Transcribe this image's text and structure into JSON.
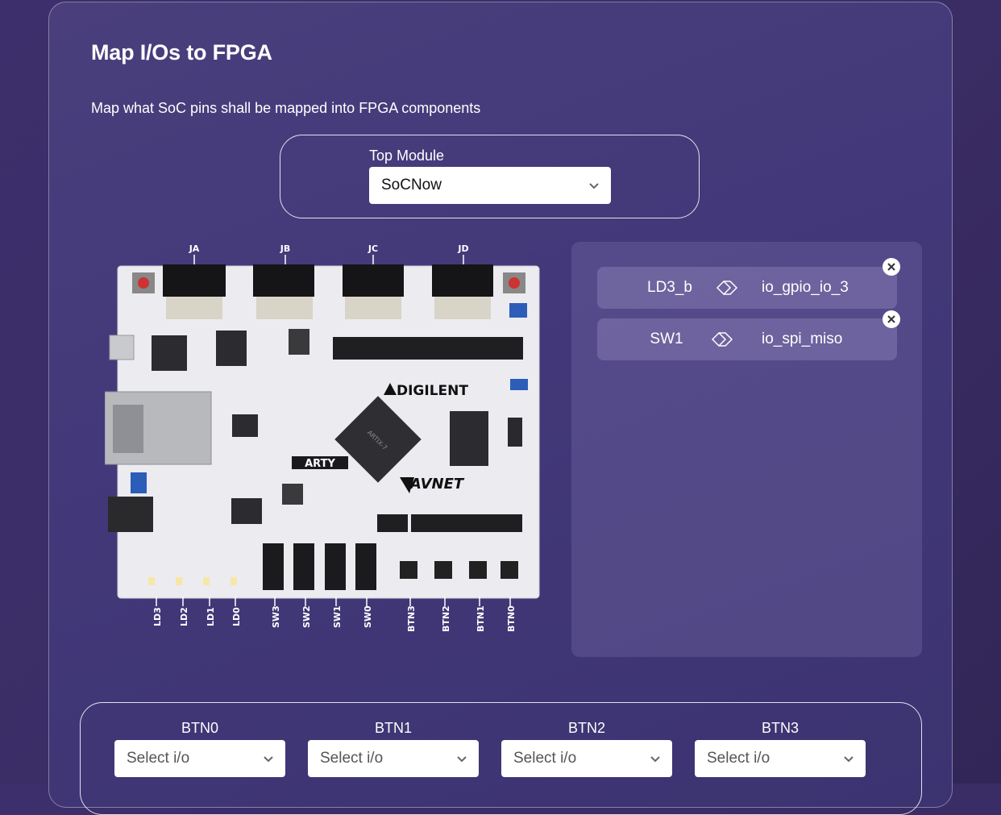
{
  "page": {
    "title": "Map I/Os to FPGA",
    "subtitle": "Map what SoC pins shall be mapped into FPGA components"
  },
  "top_module": {
    "label": "Top Module",
    "selected": "SoCNow"
  },
  "board": {
    "brand": "DIGILENT",
    "model": "ARTY",
    "vendor": "AVNET",
    "chip": "ARTIX-7",
    "pmod_headers": [
      "JA",
      "JB",
      "JC",
      "JD"
    ],
    "leds": [
      "LD3",
      "LD2",
      "LD1",
      "LD0"
    ],
    "switches": [
      "SW3",
      "SW2",
      "SW1",
      "SW0"
    ],
    "buttons": [
      "BTN3",
      "BTN2",
      "BTN1",
      "BTN0"
    ]
  },
  "mappings": [
    {
      "fpga": "LD3_b",
      "soc": "io_gpio_io_3"
    },
    {
      "fpga": "SW1",
      "soc": "io_spi_miso"
    }
  ],
  "io_selects": [
    {
      "label": "BTN0",
      "placeholder": "Select i/o"
    },
    {
      "label": "BTN1",
      "placeholder": "Select i/o"
    },
    {
      "label": "BTN2",
      "placeholder": "Select i/o"
    },
    {
      "label": "BTN3",
      "placeholder": "Select i/o"
    }
  ],
  "icons": {
    "chevron": "chevron-down-icon",
    "mapping_arrow": "double-chevron-right-icon",
    "remove": "close-icon"
  }
}
